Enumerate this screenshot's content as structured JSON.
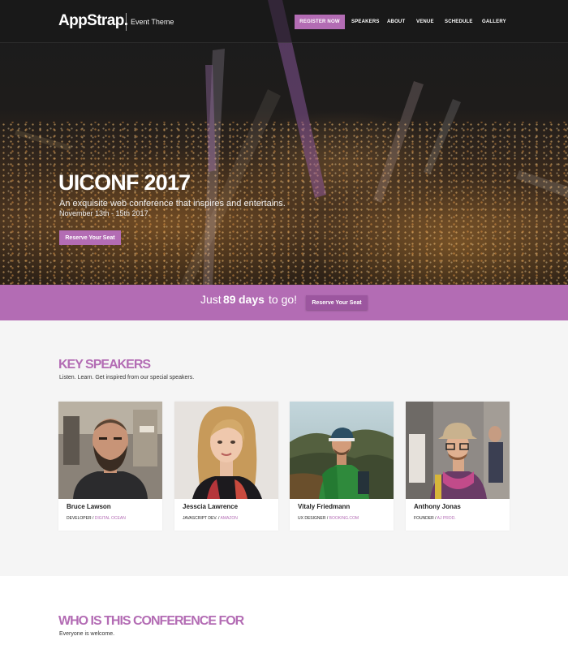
{
  "colors": {
    "accent": "#b36cb4",
    "accent_dark": "#9c569f",
    "hero_dark": "#1b1b1c",
    "section_bg": "#f5f5f5"
  },
  "brand": {
    "logo": "AppStrap.",
    "subtitle": "Event Theme"
  },
  "nav": {
    "register_label": "REGISTER NOW",
    "links": [
      "SPEAKERS",
      "ABOUT",
      "VENUE",
      "SCHEDULE",
      "GALLERY"
    ]
  },
  "hero": {
    "title": "UICONF 2017",
    "tagline": "An exquisite web conference that inspires and entertains.",
    "dates": "November 13th - 15th 2017.",
    "cta_label": "Reserve Your Seat"
  },
  "countdown": {
    "prefix": "Just",
    "days": "89",
    "unit": "days",
    "suffix": "to go!",
    "cta_label": "Reserve Your Seat"
  },
  "speakers_section": {
    "title": "KEY SPEAKERS",
    "subtitle": "Listen. Learn. Get inspired from our special speakers.",
    "speakers": [
      {
        "name": "Bruce Lawson",
        "role": "DEVELOPER",
        "company": "DIGITAL OCEAN",
        "photo": "photo-bruce-lawson"
      },
      {
        "name": "Jesscia Lawrence",
        "role": "JAVASCRIPT DEV.",
        "company": "AMAZON",
        "photo": "photo-jesscia-lawrence"
      },
      {
        "name": "Vitaly Friedmann",
        "role": "UX DESIGNER",
        "company": "BOOKING.COM",
        "photo": "photo-vitaly-friedmann"
      },
      {
        "name": "Anthony Jonas",
        "role": "FOUNDER",
        "company": "AJ PROD.",
        "photo": "photo-anthony-jonas"
      }
    ]
  },
  "who_section": {
    "title": "WHO IS THIS CONFERENCE FOR",
    "subtitle": "Everyone is welcome."
  }
}
